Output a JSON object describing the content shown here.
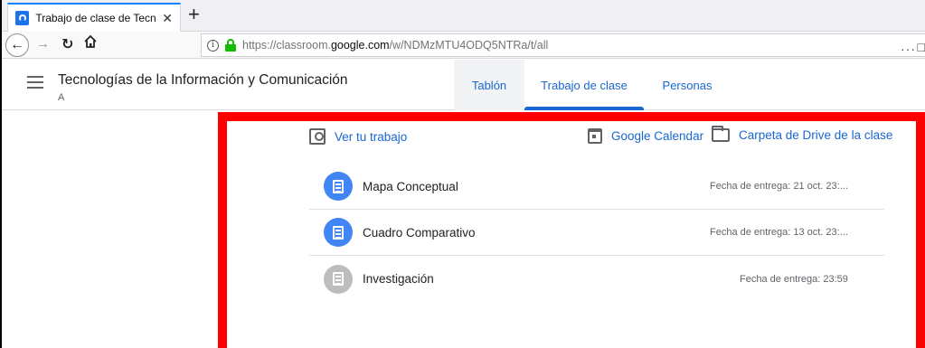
{
  "browser": {
    "tab_title": "Trabajo de clase de Tecnologí",
    "tab_close": "✕",
    "new_tab": "+",
    "url_prefix": "https://classroom.",
    "url_domain": "google.com",
    "url_path": "/w/NDMzMTU4ODQ5NTRa/t/all",
    "page_actions": "···",
    "page_actions_2": "□"
  },
  "header": {
    "class_title": "Tecnologías de la Información y Comunicación",
    "class_section": "A",
    "tabs": [
      "Tablón",
      "Trabajo de clase",
      "Personas"
    ]
  },
  "toolbar": {
    "ver_trabajo": "Ver tu trabajo",
    "calendar": "Google Calendar",
    "drive": "Carpeta de Drive de la clase"
  },
  "assignments": [
    {
      "title": "Mapa Conceptual",
      "due": "Fecha de entrega: 21 oct. 23:...",
      "status_color": "#4285f4"
    },
    {
      "title": "Cuadro Comparativo",
      "due": "Fecha de entrega: 13 oct. 23:...",
      "status_color": "#4285f4"
    },
    {
      "title": "Investigación",
      "due": "Fecha de entrega: 23:59",
      "status_color": "#bdbdbd"
    }
  ],
  "colors": {
    "accent": "#1967d2",
    "highlight": "#ff0000"
  }
}
